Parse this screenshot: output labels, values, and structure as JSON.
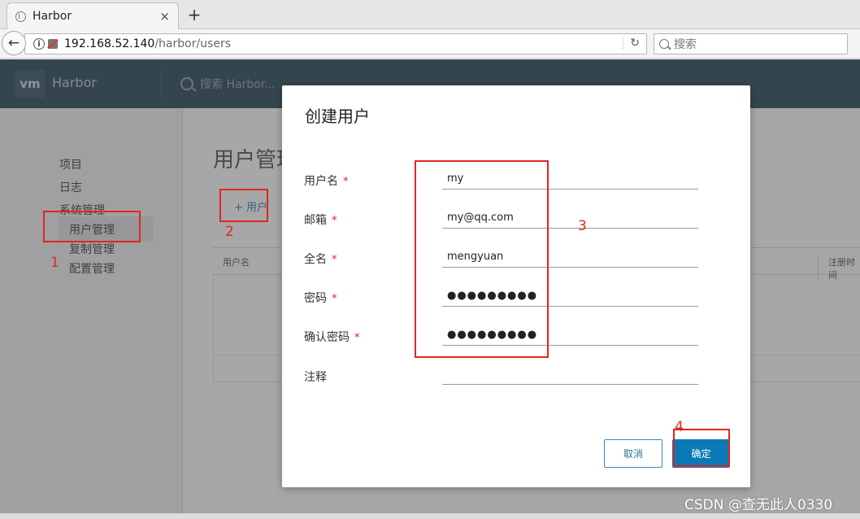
{
  "browser": {
    "tab_title": "Harbor",
    "tab_close": "×",
    "new_tab": "+",
    "url_host": "192.168.52.140",
    "url_path": "/harbor/users",
    "search_placeholder": "搜索"
  },
  "app": {
    "logo": "vm",
    "name": "Harbor",
    "search_placeholder": "搜索 Harbor..."
  },
  "sidebar": {
    "items": [
      "项目",
      "日志",
      "系统管理",
      "用户管理",
      "复制管理",
      "配置管理"
    ]
  },
  "main": {
    "title": "用户管理",
    "add_user": "+ 用户",
    "table_headers": [
      "用户名",
      "注册时间"
    ]
  },
  "modal": {
    "title": "创建用户",
    "fields": [
      {
        "label": "用户名",
        "required": "*",
        "value": "my"
      },
      {
        "label": "邮箱",
        "required": "*",
        "value": "my@qq.com"
      },
      {
        "label": "全名",
        "required": "*",
        "value": "mengyuan"
      },
      {
        "label": "密码",
        "required": "*",
        "value": "●●●●●●●●●"
      },
      {
        "label": "确认密码",
        "required": "*",
        "value": "●●●●●●●●●"
      },
      {
        "label": "注释",
        "required": "",
        "value": ""
      }
    ],
    "cancel_label": "取消",
    "ok_label": "确定"
  },
  "annotations": [
    "1",
    "2",
    "3",
    "4"
  ],
  "annotation_color": "#e0261f",
  "watermark": "CSDN @查无此人0330"
}
